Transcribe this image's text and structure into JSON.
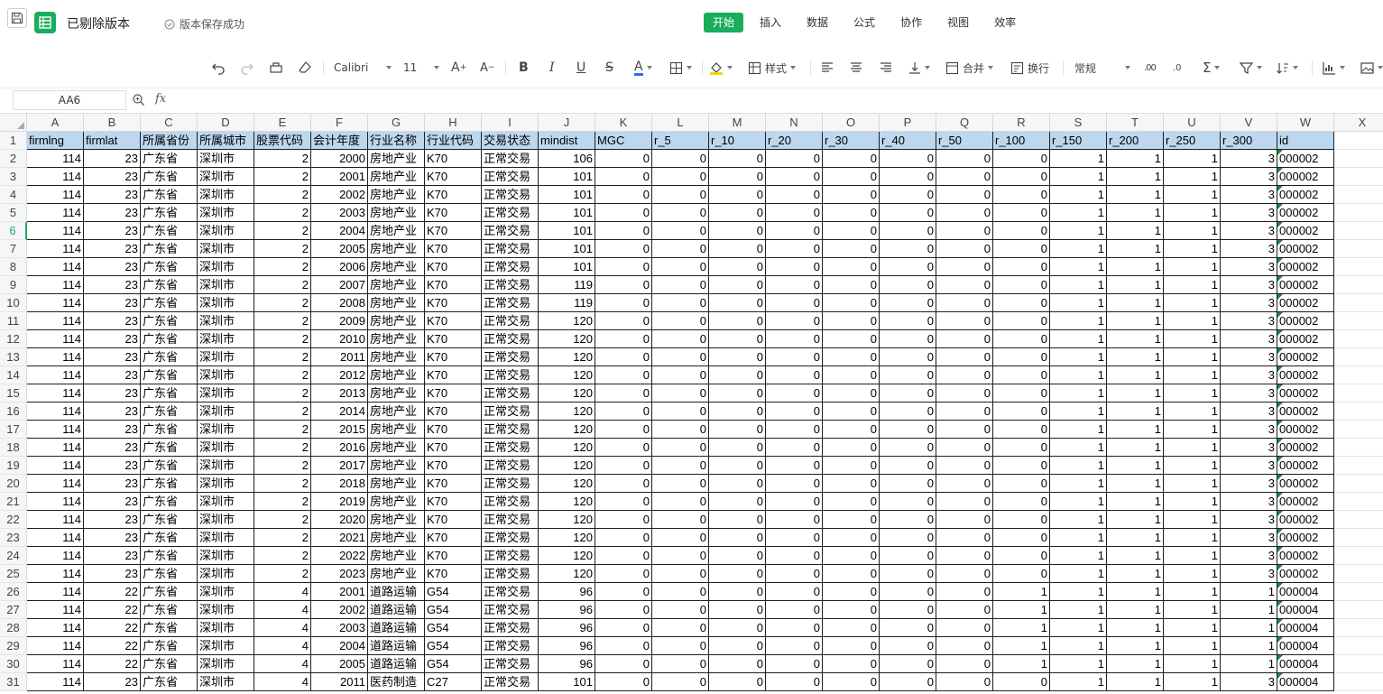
{
  "title_bar": {
    "doc_title": "已剔除版本",
    "save_status": "版本保存成功"
  },
  "menu_tabs": [
    "开始",
    "插入",
    "数据",
    "公式",
    "协作",
    "视图",
    "效率"
  ],
  "menu_active": "开始",
  "toolbar": {
    "font_name": "Calibri",
    "font_size": "11",
    "style_label": "样式",
    "merge_label": "合并",
    "wrap_label": "换行",
    "number_format": "常规"
  },
  "formula_bar": {
    "name_box": "AA6",
    "fx": "fx",
    "formula": ""
  },
  "columns": [
    "A",
    "B",
    "C",
    "D",
    "E",
    "F",
    "G",
    "H",
    "I",
    "J",
    "K",
    "L",
    "M",
    "N",
    "O",
    "P",
    "Q",
    "R",
    "S",
    "T",
    "U",
    "V",
    "W",
    "X"
  ],
  "header_row": [
    "firmlng",
    "firmlat",
    "所属省份",
    "所属城市",
    "股票代码",
    "会计年度",
    "行业名称",
    "行业代码",
    "交易状态",
    "mindist",
    "MGC",
    "r_5",
    "r_10",
    "r_20",
    "r_30",
    "r_40",
    "r_50",
    "r_100",
    "r_150",
    "r_200",
    "r_250",
    "r_300",
    "id"
  ],
  "active_row": 6,
  "rows": [
    [
      "114",
      "23",
      "广东省",
      "深圳市",
      "2",
      "2000",
      "房地产业",
      "K70",
      "正常交易",
      "106",
      "0",
      "0",
      "0",
      "0",
      "0",
      "0",
      "0",
      "0",
      "1",
      "1",
      "1",
      "3",
      "000002"
    ],
    [
      "114",
      "23",
      "广东省",
      "深圳市",
      "2",
      "2001",
      "房地产业",
      "K70",
      "正常交易",
      "101",
      "0",
      "0",
      "0",
      "0",
      "0",
      "0",
      "0",
      "0",
      "1",
      "1",
      "1",
      "3",
      "000002"
    ],
    [
      "114",
      "23",
      "广东省",
      "深圳市",
      "2",
      "2002",
      "房地产业",
      "K70",
      "正常交易",
      "101",
      "0",
      "0",
      "0",
      "0",
      "0",
      "0",
      "0",
      "0",
      "1",
      "1",
      "1",
      "3",
      "000002"
    ],
    [
      "114",
      "23",
      "广东省",
      "深圳市",
      "2",
      "2003",
      "房地产业",
      "K70",
      "正常交易",
      "101",
      "0",
      "0",
      "0",
      "0",
      "0",
      "0",
      "0",
      "0",
      "1",
      "1",
      "1",
      "3",
      "000002"
    ],
    [
      "114",
      "23",
      "广东省",
      "深圳市",
      "2",
      "2004",
      "房地产业",
      "K70",
      "正常交易",
      "101",
      "0",
      "0",
      "0",
      "0",
      "0",
      "0",
      "0",
      "0",
      "1",
      "1",
      "1",
      "3",
      "000002"
    ],
    [
      "114",
      "23",
      "广东省",
      "深圳市",
      "2",
      "2005",
      "房地产业",
      "K70",
      "正常交易",
      "101",
      "0",
      "0",
      "0",
      "0",
      "0",
      "0",
      "0",
      "0",
      "1",
      "1",
      "1",
      "3",
      "000002"
    ],
    [
      "114",
      "23",
      "广东省",
      "深圳市",
      "2",
      "2006",
      "房地产业",
      "K70",
      "正常交易",
      "101",
      "0",
      "0",
      "0",
      "0",
      "0",
      "0",
      "0",
      "0",
      "1",
      "1",
      "1",
      "3",
      "000002"
    ],
    [
      "114",
      "23",
      "广东省",
      "深圳市",
      "2",
      "2007",
      "房地产业",
      "K70",
      "正常交易",
      "119",
      "0",
      "0",
      "0",
      "0",
      "0",
      "0",
      "0",
      "0",
      "1",
      "1",
      "1",
      "3",
      "000002"
    ],
    [
      "114",
      "23",
      "广东省",
      "深圳市",
      "2",
      "2008",
      "房地产业",
      "K70",
      "正常交易",
      "119",
      "0",
      "0",
      "0",
      "0",
      "0",
      "0",
      "0",
      "0",
      "1",
      "1",
      "1",
      "3",
      "000002"
    ],
    [
      "114",
      "23",
      "广东省",
      "深圳市",
      "2",
      "2009",
      "房地产业",
      "K70",
      "正常交易",
      "120",
      "0",
      "0",
      "0",
      "0",
      "0",
      "0",
      "0",
      "0",
      "1",
      "1",
      "1",
      "3",
      "000002"
    ],
    [
      "114",
      "23",
      "广东省",
      "深圳市",
      "2",
      "2010",
      "房地产业",
      "K70",
      "正常交易",
      "120",
      "0",
      "0",
      "0",
      "0",
      "0",
      "0",
      "0",
      "0",
      "1",
      "1",
      "1",
      "3",
      "000002"
    ],
    [
      "114",
      "23",
      "广东省",
      "深圳市",
      "2",
      "2011",
      "房地产业",
      "K70",
      "正常交易",
      "120",
      "0",
      "0",
      "0",
      "0",
      "0",
      "0",
      "0",
      "0",
      "1",
      "1",
      "1",
      "3",
      "000002"
    ],
    [
      "114",
      "23",
      "广东省",
      "深圳市",
      "2",
      "2012",
      "房地产业",
      "K70",
      "正常交易",
      "120",
      "0",
      "0",
      "0",
      "0",
      "0",
      "0",
      "0",
      "0",
      "1",
      "1",
      "1",
      "3",
      "000002"
    ],
    [
      "114",
      "23",
      "广东省",
      "深圳市",
      "2",
      "2013",
      "房地产业",
      "K70",
      "正常交易",
      "120",
      "0",
      "0",
      "0",
      "0",
      "0",
      "0",
      "0",
      "0",
      "1",
      "1",
      "1",
      "3",
      "000002"
    ],
    [
      "114",
      "23",
      "广东省",
      "深圳市",
      "2",
      "2014",
      "房地产业",
      "K70",
      "正常交易",
      "120",
      "0",
      "0",
      "0",
      "0",
      "0",
      "0",
      "0",
      "0",
      "1",
      "1",
      "1",
      "3",
      "000002"
    ],
    [
      "114",
      "23",
      "广东省",
      "深圳市",
      "2",
      "2015",
      "房地产业",
      "K70",
      "正常交易",
      "120",
      "0",
      "0",
      "0",
      "0",
      "0",
      "0",
      "0",
      "0",
      "1",
      "1",
      "1",
      "3",
      "000002"
    ],
    [
      "114",
      "23",
      "广东省",
      "深圳市",
      "2",
      "2016",
      "房地产业",
      "K70",
      "正常交易",
      "120",
      "0",
      "0",
      "0",
      "0",
      "0",
      "0",
      "0",
      "0",
      "1",
      "1",
      "1",
      "3",
      "000002"
    ],
    [
      "114",
      "23",
      "广东省",
      "深圳市",
      "2",
      "2017",
      "房地产业",
      "K70",
      "正常交易",
      "120",
      "0",
      "0",
      "0",
      "0",
      "0",
      "0",
      "0",
      "0",
      "1",
      "1",
      "1",
      "3",
      "000002"
    ],
    [
      "114",
      "23",
      "广东省",
      "深圳市",
      "2",
      "2018",
      "房地产业",
      "K70",
      "正常交易",
      "120",
      "0",
      "0",
      "0",
      "0",
      "0",
      "0",
      "0",
      "0",
      "1",
      "1",
      "1",
      "3",
      "000002"
    ],
    [
      "114",
      "23",
      "广东省",
      "深圳市",
      "2",
      "2019",
      "房地产业",
      "K70",
      "正常交易",
      "120",
      "0",
      "0",
      "0",
      "0",
      "0",
      "0",
      "0",
      "0",
      "1",
      "1",
      "1",
      "3",
      "000002"
    ],
    [
      "114",
      "23",
      "广东省",
      "深圳市",
      "2",
      "2020",
      "房地产业",
      "K70",
      "正常交易",
      "120",
      "0",
      "0",
      "0",
      "0",
      "0",
      "0",
      "0",
      "0",
      "1",
      "1",
      "1",
      "3",
      "000002"
    ],
    [
      "114",
      "23",
      "广东省",
      "深圳市",
      "2",
      "2021",
      "房地产业",
      "K70",
      "正常交易",
      "120",
      "0",
      "0",
      "0",
      "0",
      "0",
      "0",
      "0",
      "0",
      "1",
      "1",
      "1",
      "3",
      "000002"
    ],
    [
      "114",
      "23",
      "广东省",
      "深圳市",
      "2",
      "2022",
      "房地产业",
      "K70",
      "正常交易",
      "120",
      "0",
      "0",
      "0",
      "0",
      "0",
      "0",
      "0",
      "0",
      "1",
      "1",
      "1",
      "3",
      "000002"
    ],
    [
      "114",
      "23",
      "广东省",
      "深圳市",
      "2",
      "2023",
      "房地产业",
      "K70",
      "正常交易",
      "120",
      "0",
      "0",
      "0",
      "0",
      "0",
      "0",
      "0",
      "0",
      "1",
      "1",
      "1",
      "3",
      "000002"
    ],
    [
      "114",
      "22",
      "广东省",
      "深圳市",
      "4",
      "2001",
      "道路运输",
      "G54",
      "正常交易",
      "96",
      "0",
      "0",
      "0",
      "0",
      "0",
      "0",
      "0",
      "1",
      "1",
      "1",
      "1",
      "1",
      "000004"
    ],
    [
      "114",
      "22",
      "广东省",
      "深圳市",
      "4",
      "2002",
      "道路运输",
      "G54",
      "正常交易",
      "96",
      "0",
      "0",
      "0",
      "0",
      "0",
      "0",
      "0",
      "1",
      "1",
      "1",
      "1",
      "1",
      "000004"
    ],
    [
      "114",
      "22",
      "广东省",
      "深圳市",
      "4",
      "2003",
      "道路运输",
      "G54",
      "正常交易",
      "96",
      "0",
      "0",
      "0",
      "0",
      "0",
      "0",
      "0",
      "1",
      "1",
      "1",
      "1",
      "1",
      "000004"
    ],
    [
      "114",
      "22",
      "广东省",
      "深圳市",
      "4",
      "2004",
      "道路运输",
      "G54",
      "正常交易",
      "96",
      "0",
      "0",
      "0",
      "0",
      "0",
      "0",
      "0",
      "1",
      "1",
      "1",
      "1",
      "1",
      "000004"
    ],
    [
      "114",
      "22",
      "广东省",
      "深圳市",
      "4",
      "2005",
      "道路运输",
      "G54",
      "正常交易",
      "96",
      "0",
      "0",
      "0",
      "0",
      "0",
      "0",
      "0",
      "1",
      "1",
      "1",
      "1",
      "1",
      "000004"
    ],
    [
      "114",
      "23",
      "广东省",
      "深圳市",
      "4",
      "2011",
      "医药制造",
      "C27",
      "正常交易",
      "101",
      "0",
      "0",
      "0",
      "0",
      "0",
      "0",
      "0",
      "0",
      "1",
      "1",
      "1",
      "3",
      "000004"
    ]
  ],
  "icons": {
    "save": "floppy-disk-icon",
    "app": "sheet-app-icon",
    "status": "check-circle-icon"
  },
  "colors": {
    "accent": "#1aad5e",
    "header_fill": "#bdd7ee"
  }
}
